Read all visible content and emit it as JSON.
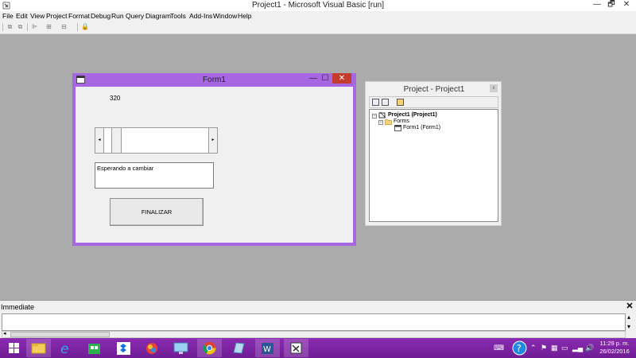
{
  "window": {
    "title": "Project1 - Microsoft Visual Basic [run]",
    "minimize": "—",
    "restore": "🗗",
    "close": "✕"
  },
  "menu": [
    "File",
    "Edit",
    "View",
    "Project",
    "Format",
    "Debug",
    "Run",
    "Query",
    "Diagram",
    "Tools",
    "Add-Ins",
    "Window",
    "Help"
  ],
  "toolbar_icons": [
    "link-icon",
    "unlink-icon",
    "align-icon",
    "center-icon",
    "size-icon",
    "lock-icon"
  ],
  "form1": {
    "title": "Form1",
    "label_value": "320",
    "status_text": "Esperando a cambiar",
    "button_label": "FINALIZAR",
    "scroll_left": "◂",
    "scroll_right": "▸",
    "close": "✕",
    "minimize": "—",
    "maximize": "☐"
  },
  "project": {
    "title": "Project - Project1",
    "close": "x",
    "tree": {
      "root": "Project1 (Project1)",
      "folder": "Forms",
      "item": "Form1 (Form1)"
    }
  },
  "immediate": {
    "title": "Immediate",
    "close": "✕",
    "scroll_up": "▴",
    "scroll_down": "▾",
    "scroll_left": "◂"
  },
  "taskbar": {
    "apps": [
      "windows-start",
      "file-explorer",
      "internet-explorer",
      "store",
      "dropbox",
      "photos",
      "remote-desktop",
      "chrome",
      "notes",
      "word",
      "visual-basic"
    ],
    "clock_time": "11:29 p. m.",
    "clock_date": "26/02/2016"
  },
  "colors": {
    "form_border": "#a767e2",
    "taskbar": "#7b1fa2",
    "close_red": "#c43c2b",
    "desktop": "#ababab"
  }
}
